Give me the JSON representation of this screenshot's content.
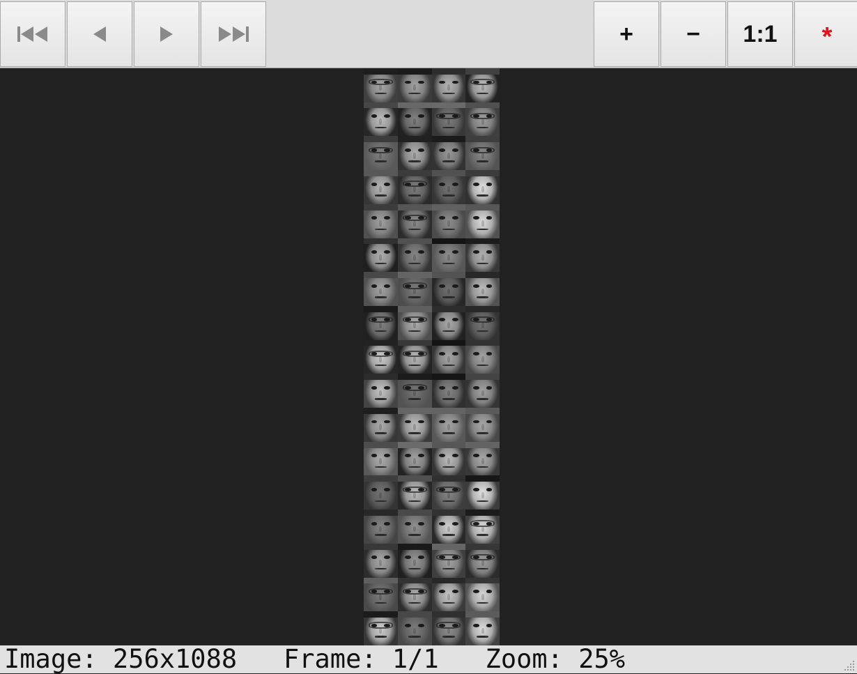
{
  "toolbar": {
    "first_icon": "skip-to-first-icon",
    "prev_icon": "previous-frame-icon",
    "next_icon": "next-frame-icon",
    "last_icon": "skip-to-last-icon",
    "zoom_in_label": "+",
    "zoom_out_label": "−",
    "actual_size_label": "1:1",
    "star_label": "*",
    "star_color": "#e0121a"
  },
  "viewer": {
    "background": "#212121",
    "mosaic": {
      "columns": 4,
      "rows": 17
    }
  },
  "status": {
    "text": "Image: 256x1088   Frame: 1/1   Zoom: 25%"
  }
}
